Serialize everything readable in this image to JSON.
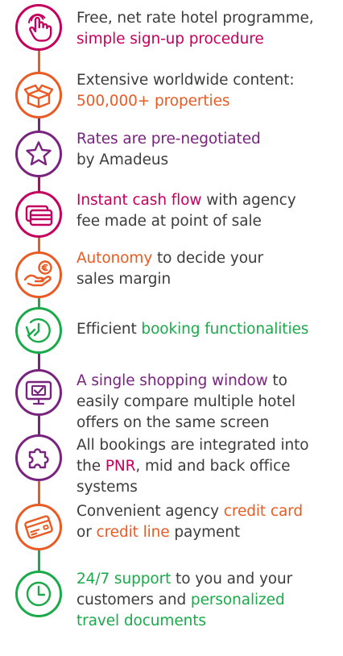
{
  "colors": {
    "purple": "#78247e",
    "magenta": "#c4005e",
    "orange": "#ea5b24",
    "green": "#1aaa4a",
    "text": "#3d3d3d"
  },
  "items": [
    {
      "icon": "pointing-hand-icon",
      "color": "magenta",
      "segments": [
        {
          "text": "Free, net rate hotel programme,",
          "color": "text"
        },
        {
          "text": "\n",
          "color": "text"
        },
        {
          "text": "simple sign-up procedure",
          "color": "magenta"
        }
      ]
    },
    {
      "icon": "open-box-icon",
      "color": "orange",
      "segments": [
        {
          "text": "Extensive worldwide content:",
          "color": "text"
        },
        {
          "text": "\n",
          "color": "text"
        },
        {
          "text": "500,000+ properties",
          "color": "orange"
        }
      ]
    },
    {
      "icon": "star-icon",
      "color": "purple",
      "segments": [
        {
          "text": "Rates are pre-negotiated",
          "color": "purple"
        },
        {
          "text": "\n",
          "color": "text"
        },
        {
          "text": "by Amadeus",
          "color": "text"
        }
      ]
    },
    {
      "icon": "cards-icon",
      "color": "magenta",
      "segments": [
        {
          "text": "Instant cash flow",
          "color": "magenta"
        },
        {
          "text": " with agency",
          "color": "text"
        },
        {
          "text": "\n",
          "color": "text"
        },
        {
          "text": "fee made at point of sale",
          "color": "text"
        }
      ]
    },
    {
      "icon": "hand-euro-coin-icon",
      "color": "orange",
      "segments": [
        {
          "text": "Autonomy",
          "color": "orange"
        },
        {
          "text": " to decide your",
          "color": "text"
        },
        {
          "text": "\n",
          "color": "text"
        },
        {
          "text": "sales margin",
          "color": "text"
        }
      ]
    },
    {
      "icon": "clock-refresh-icon",
      "color": "green",
      "segments": [
        {
          "text": "Efficient ",
          "color": "text"
        },
        {
          "text": "booking functionalities",
          "color": "green"
        }
      ]
    },
    {
      "icon": "monitor-check-icon",
      "color": "purple",
      "segments": [
        {
          "text": "A single shopping window",
          "color": "purple"
        },
        {
          "text": " to",
          "color": "text"
        },
        {
          "text": "\n",
          "color": "text"
        },
        {
          "text": "easily compare multiple hotel",
          "color": "text"
        },
        {
          "text": "\n",
          "color": "text"
        },
        {
          "text": "offers on the same screen",
          "color": "text"
        }
      ]
    },
    {
      "icon": "puzzle-icon",
      "color": "purple",
      "segments": [
        {
          "text": "All bookings are integrated into",
          "color": "text"
        },
        {
          "text": "\n",
          "color": "text"
        },
        {
          "text": "the ",
          "color": "text"
        },
        {
          "text": "PNR",
          "color": "magenta"
        },
        {
          "text": ", mid and back office",
          "color": "text"
        },
        {
          "text": "\n",
          "color": "text"
        },
        {
          "text": "systems",
          "color": "text"
        }
      ]
    },
    {
      "icon": "credit-card-icon",
      "color": "orange",
      "segments": [
        {
          "text": "Convenient agency ",
          "color": "text"
        },
        {
          "text": "credit card",
          "color": "orange"
        },
        {
          "text": "\n",
          "color": "text"
        },
        {
          "text": "or ",
          "color": "text"
        },
        {
          "text": "credit line",
          "color": "orange"
        },
        {
          "text": " payment",
          "color": "text"
        }
      ]
    },
    {
      "icon": "clock-icon",
      "color": "green",
      "segments": [
        {
          "text": "24/7 support",
          "color": "green"
        },
        {
          "text": " to you and your",
          "color": "text"
        },
        {
          "text": "\n",
          "color": "text"
        },
        {
          "text": "customers and ",
          "color": "text"
        },
        {
          "text": "personalized",
          "color": "green"
        },
        {
          "text": "\n",
          "color": "text"
        },
        {
          "text": "travel documents",
          "color": "green"
        }
      ]
    }
  ]
}
